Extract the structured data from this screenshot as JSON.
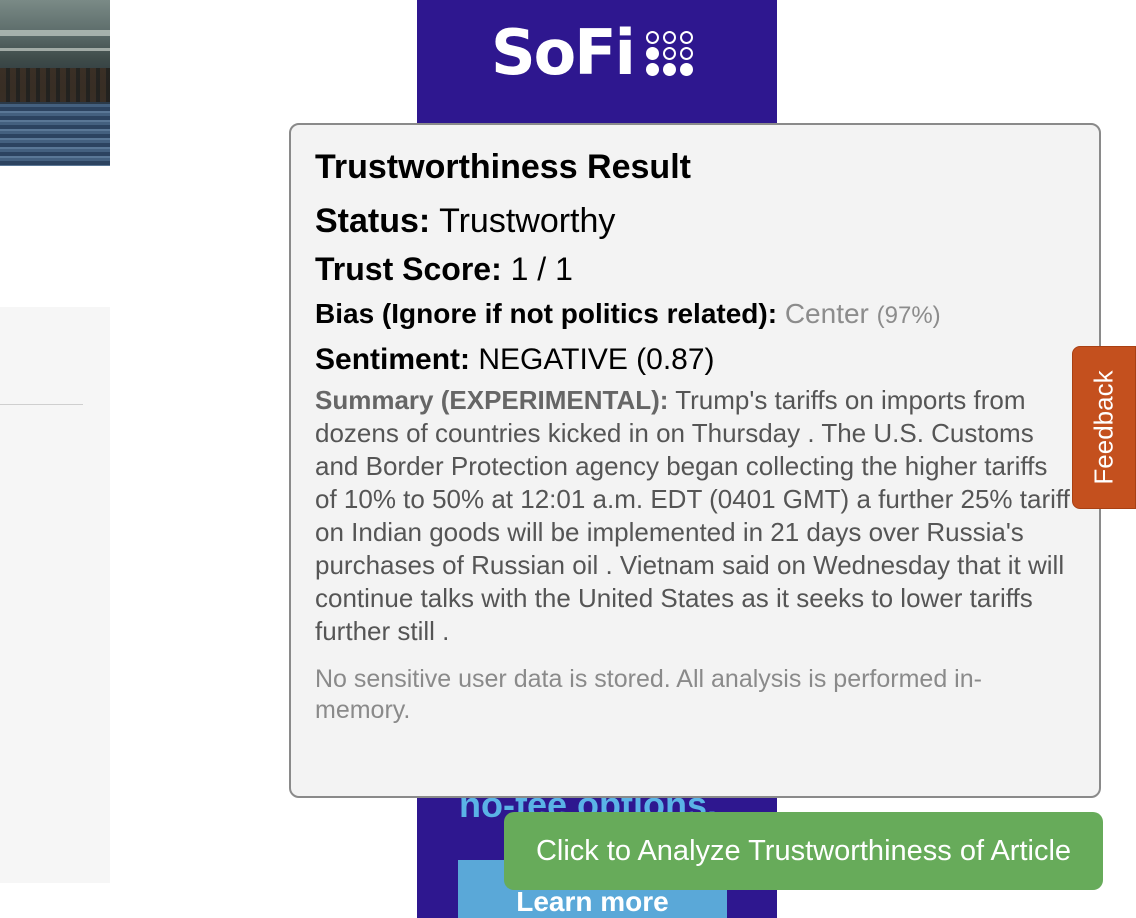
{
  "ad": {
    "brand": "SoFi",
    "promo_text": "no-fee options.",
    "cta_label": "Learn more",
    "colors": {
      "background": "#2e178f",
      "cta": "#5aa8d8",
      "promo": "#5ab3e6"
    }
  },
  "popover": {
    "title": "Trustworthiness Result",
    "status": {
      "label": "Status:",
      "value": "Trustworthy"
    },
    "trust_score": {
      "label": "Trust Score:",
      "value": "1 / 1"
    },
    "bias": {
      "label": "Bias (Ignore if not politics related):",
      "value": "Center",
      "confidence": "(97%)"
    },
    "sentiment": {
      "label": "Sentiment:",
      "value": "NEGATIVE (0.87)"
    },
    "summary": {
      "label": "Summary (EXPERIMENTAL):",
      "text": "Trump's tariffs on imports from dozens of countries kicked in on Thursday . The U.S. Customs and Border Protection agency began collecting the higher tariffs of 10% to 50% at 12:01 a.m. EDT (0401 GMT) a further 25% tariff on Indian goods will be implemented in 21 days over Russia's purchases of Russian oil . Vietnam said on Wednesday that it will continue talks with the United States as it seeks to lower tariffs further still ."
    },
    "privacy_note": "No sensitive user data is stored. All analysis is performed in-memory."
  },
  "feedback_tab": {
    "label": "Feedback",
    "color": "#c4501e"
  },
  "analyze_button": {
    "label": "Click to Analyze Trustworthiness of Article",
    "color": "#67ab5a"
  }
}
